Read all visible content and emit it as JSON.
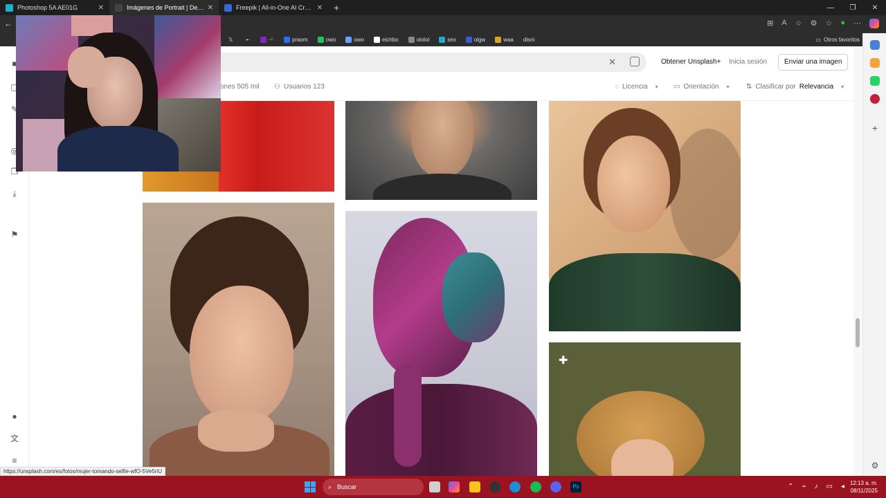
{
  "tabs": [
    {
      "title": "Photoshop 5A AE01G",
      "active": false,
      "color": "#1fb0c8"
    },
    {
      "title": "Imágenes de Portrait | Descarga",
      "active": true,
      "color": "#444444"
    },
    {
      "title": "Freepik | All-in-One AI Creative Su",
      "active": false,
      "color": "#3867d6"
    }
  ],
  "bookmarks": [
    {
      "label": "",
      "color": "#ffffff"
    },
    {
      "label": "·•·",
      "color": "#7b2cbf"
    },
    {
      "label": "·ᵕ̈·",
      "color": "#7b2cbf"
    },
    {
      "label": "praom",
      "color": "#2b6cff"
    },
    {
      "label": "owo",
      "color": "#24c05a"
    },
    {
      "label": "owo",
      "color": "#6aa0ff"
    },
    {
      "label": "eichbo",
      "color": "#ffffff"
    },
    {
      "label": "ololol",
      "color": "#888888"
    },
    {
      "label": "sex",
      "color": "#22aacc"
    },
    {
      "label": "olgw",
      "color": "#3a5bd9"
    },
    {
      "label": "waa",
      "color": "#e0a030"
    },
    {
      "label": "disni",
      "color": "#2d2d2d"
    }
  ],
  "bookmarks_other": "Otros favoritos",
  "header": {
    "unsplash_plus": "Obtener Unsplash+",
    "login": "Inicia sesión",
    "submit": "Enviar una imagen"
  },
  "filters": {
    "collections": "ones 505 mil",
    "users": "Usuarios 123",
    "license": "Licencia",
    "orientation": "Orientación",
    "sort_prefix": "Clasificar por",
    "sort_value": "Relevancia"
  },
  "status_url": "https://unsplash.com/es/fotos/mujer-tomando-selfie-wfO-5Ve5riU",
  "taskbar": {
    "search": "Buscar",
    "time": "12:13 a. m.",
    "date": "08/11/2025"
  },
  "icons": {
    "search": "🔍",
    "close": "✕",
    "plus": "+"
  }
}
